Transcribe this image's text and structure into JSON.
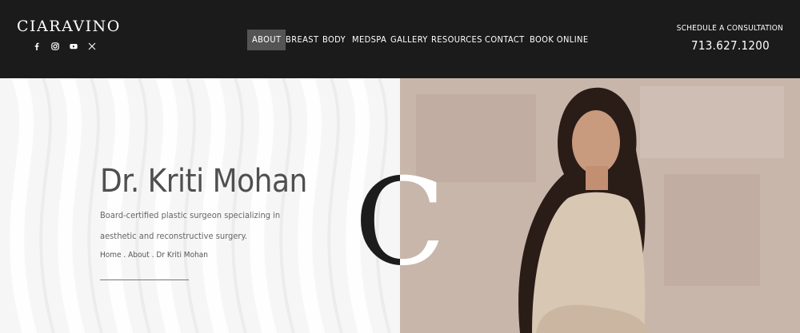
{
  "brand": {
    "logo_text": "CIARAVINO"
  },
  "social": [
    {
      "name": "facebook-icon"
    },
    {
      "name": "instagram-icon"
    },
    {
      "name": "youtube-icon"
    },
    {
      "name": "x-icon"
    }
  ],
  "nav": {
    "items": [
      {
        "label": "ABOUT",
        "active": true
      },
      {
        "label": "BREAST"
      },
      {
        "label": "BODY"
      },
      {
        "label": "MEDSPA"
      },
      {
        "label": "GALLERY"
      },
      {
        "label": "RESOURCES"
      },
      {
        "label": "CONTACT"
      },
      {
        "label": "BOOK ONLINE"
      }
    ]
  },
  "cta": {
    "schedule_label": "SCHEDULE A CONSULTATION",
    "phone": "713.627.1200"
  },
  "hero": {
    "title": "Dr. Kriti Mohan",
    "subtitle": "Board-certified plastic surgeon specializing in aesthetic and reconstructive surgery.",
    "breadcrumb": {
      "home": "Home",
      "sep": " . ",
      "about": "About",
      "current": "Dr Kriti Mohan"
    },
    "monogram": "C"
  },
  "colors": {
    "header_bg": "#1b1b1b",
    "active_nav_bg": "#545454",
    "photo_bg": "#c9b7ad"
  }
}
